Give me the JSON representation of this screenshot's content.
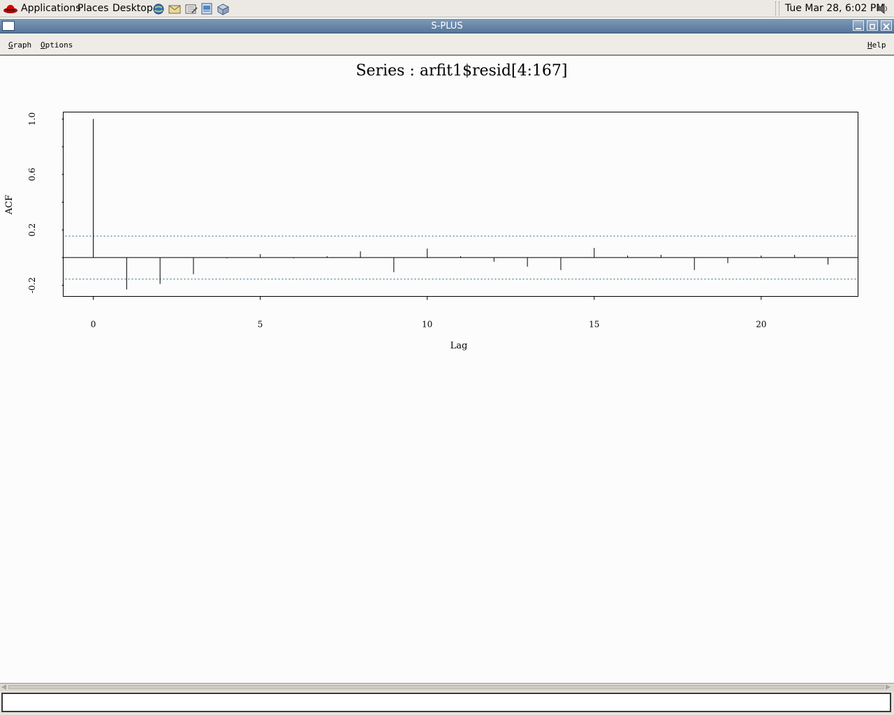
{
  "panel": {
    "applications_label": "Applications",
    "places_label": "Places",
    "desktop_label": "Desktop",
    "launchers": [
      "web-browser-icon",
      "email-icon",
      "text-editor-icon",
      "presentation-icon",
      "package-manager-icon"
    ],
    "clock": "Tue Mar 28,  6:02 PM"
  },
  "window": {
    "title": "S-PLUS"
  },
  "menu": {
    "graph_label": "Graph",
    "options_label": "Options",
    "help_label": "Help"
  },
  "chart_data": {
    "type": "bar",
    "title": "Series : arfit1$resid[4:167]",
    "xlabel": "Lag",
    "ylabel": "ACF",
    "x": [
      0,
      1,
      2,
      3,
      4,
      5,
      6,
      7,
      8,
      9,
      10,
      11,
      12,
      13,
      14,
      15,
      16,
      17,
      18,
      19,
      20,
      21,
      22
    ],
    "values": [
      1.0,
      -0.23,
      -0.19,
      -0.12,
      -0.005,
      0.025,
      -0.005,
      0.01,
      0.045,
      -0.105,
      0.065,
      0.01,
      -0.03,
      -0.065,
      -0.09,
      0.07,
      0.015,
      0.02,
      -0.09,
      -0.04,
      0.015,
      0.02,
      -0.05
    ],
    "confidence_bound": 0.155,
    "xticks": [
      0,
      5,
      10,
      15,
      20
    ],
    "xtick_labels": [
      "0",
      "5",
      "10",
      "15",
      "20"
    ],
    "yticks": [
      -0.2,
      0.2,
      0.6,
      1.0
    ],
    "ytick_labels": [
      "-0.2",
      "0.2",
      "0.6",
      "1.0"
    ],
    "xlim": [
      -0.9,
      22.9
    ],
    "ylim": [
      -0.28,
      1.05
    ],
    "grid": false
  },
  "command_line": {
    "value": ""
  }
}
